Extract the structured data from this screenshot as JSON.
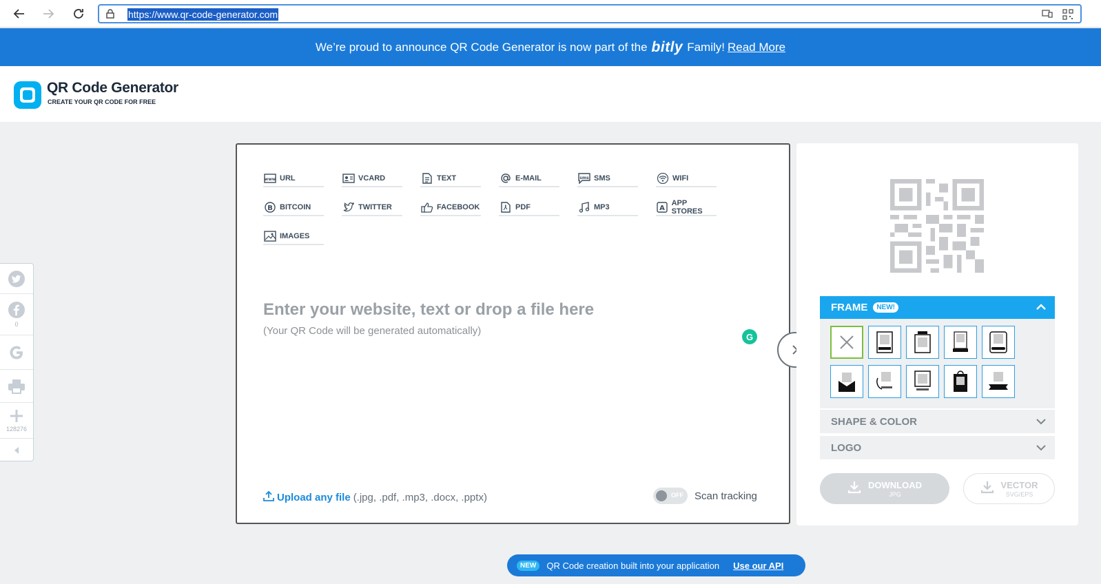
{
  "browser": {
    "url": "https://www.qr-code-generator.com"
  },
  "banner": {
    "text": "We’re proud to announce QR Code Generator is now part of the",
    "brand": "bitly",
    "suffix": "Family!",
    "link": "Read More"
  },
  "header": {
    "title": "QR Code Generator",
    "subtitle": "CREATE YOUR QR CODE FOR FREE"
  },
  "share": {
    "facebook_count": "0",
    "more_count": "128276"
  },
  "types": [
    {
      "label": "URL",
      "icon": "www-icon"
    },
    {
      "label": "VCARD",
      "icon": "vcard-icon"
    },
    {
      "label": "TEXT",
      "icon": "text-icon"
    },
    {
      "label": "E-MAIL",
      "icon": "at-icon"
    },
    {
      "label": "SMS",
      "icon": "sms-icon"
    },
    {
      "label": "WIFI",
      "icon": "wifi-icon"
    },
    {
      "label": "BITCOIN",
      "icon": "bitcoin-icon"
    },
    {
      "label": "TWITTER",
      "icon": "twitter-icon"
    },
    {
      "label": "FACEBOOK",
      "icon": "thumbs-up-icon"
    },
    {
      "label": "PDF",
      "icon": "pdf-icon"
    },
    {
      "label": "MP3",
      "icon": "music-note-icon"
    },
    {
      "label": "APP STORES",
      "icon": "app-store-icon"
    },
    {
      "label": "IMAGES",
      "icon": "image-icon"
    }
  ],
  "main": {
    "placeholder": "Enter your website, text or drop a file here",
    "hint": "(Your QR Code will be generated automatically)",
    "upload_link": "Upload any file",
    "upload_ext": "(.jpg, .pdf, .mp3, .docx, .pptx)",
    "toggle_state": "OFF",
    "tracking_label": "Scan tracking"
  },
  "customize": {
    "frame_label": "FRAME",
    "frame_badge": "NEW!",
    "shape_label": "SHAPE & COLOR",
    "logo_label": "LOGO"
  },
  "download": {
    "primary": "DOWNLOAD",
    "primary_sub": "JPG",
    "secondary": "VECTOR",
    "secondary_sub": "SVG/EPS"
  },
  "api": {
    "badge": "NEW",
    "text": "QR Code creation built into your application",
    "cta": "Use our API"
  },
  "colors": {
    "brand_blue": "#1b7ad8",
    "accent_cyan": "#1aa6ee",
    "selected_green": "#7bbf3d"
  }
}
